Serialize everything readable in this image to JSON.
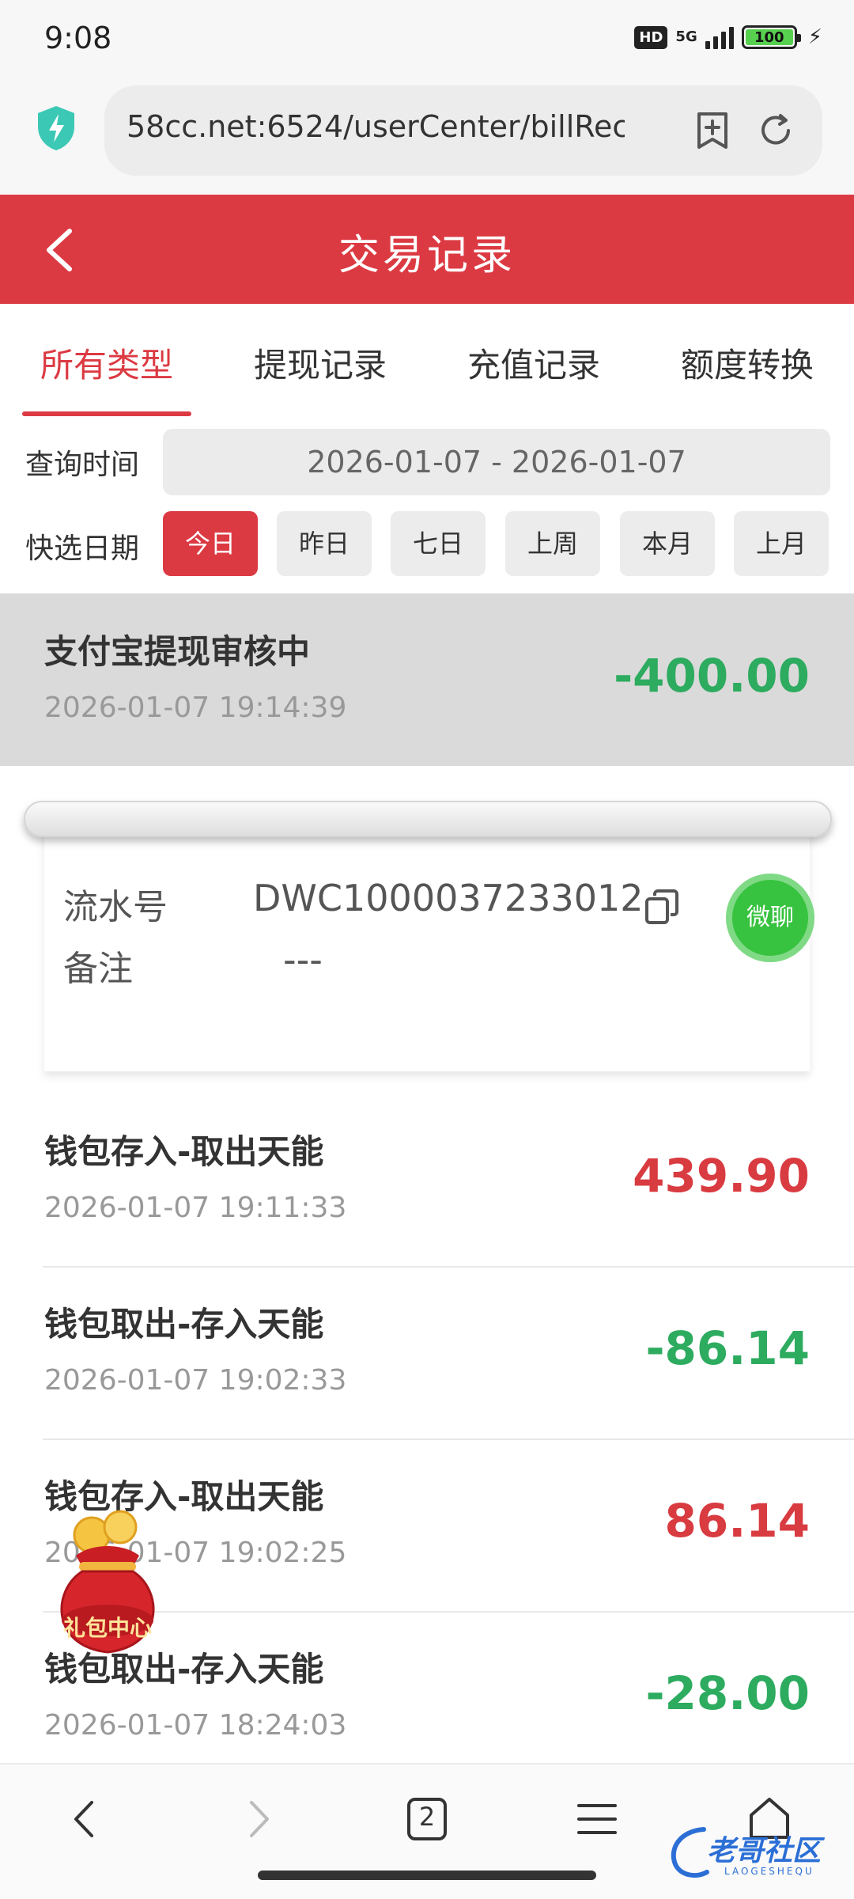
{
  "status_bar": {
    "time": "9:08",
    "hd": "HD",
    "network": "5G",
    "battery": "100"
  },
  "browser": {
    "url": "58cc.net:6524/userCenter/billRec"
  },
  "header": {
    "title": "交易记录"
  },
  "tabs": [
    {
      "label": "所有类型",
      "active": true
    },
    {
      "label": "提现记录",
      "active": false
    },
    {
      "label": "充值记录",
      "active": false
    },
    {
      "label": "额度转换",
      "active": false
    }
  ],
  "query": {
    "time_label": "查询时间",
    "date_range": "2026-01-07 - 2026-01-07",
    "quick_label": "快选日期",
    "quick_options": [
      "今日",
      "昨日",
      "七日",
      "上周",
      "本月",
      "上月"
    ],
    "quick_selected": "今日"
  },
  "records": [
    {
      "name": "支付宝提现审核中",
      "time": "2026-01-07 19:14:39",
      "amount": "-400.00"
    },
    {
      "name": "钱包存入-取出天能",
      "time": "2026-01-07 19:11:33",
      "amount": "439.90"
    },
    {
      "name": "钱包取出-存入天能",
      "time": "2026-01-07 19:02:33",
      "amount": "-86.14"
    },
    {
      "name": "钱包存入-取出天能",
      "time": "2026-01-07 19:02:25",
      "amount": "86.14"
    },
    {
      "name": "钱包取出-存入天能",
      "time": "2026-01-07 18:24:03",
      "amount": "-28.00"
    }
  ],
  "receipt": {
    "serial_label": "流水号",
    "serial_value": "DWC1000037233012",
    "note_label": "备注",
    "note_value": "---"
  },
  "floating": {
    "chat_label": "微聊",
    "gift_label": "礼包中心"
  },
  "bottom_nav": {
    "tab_count": "2"
  },
  "watermark": {
    "text": "老哥社区",
    "sub": "LAOGESHEQU"
  },
  "colors": {
    "brand_red": "#dc3a43",
    "negative_green": "#2dab5f",
    "positive_red": "#d83b40",
    "chat_green": "#37c23f"
  },
  "icons": [
    "shield-icon",
    "bookmark-add-icon",
    "refresh-icon",
    "back-arrow-icon",
    "copy-icon",
    "nav-back-icon",
    "nav-forward-icon",
    "tabs-icon",
    "menu-icon",
    "home-icon"
  ]
}
